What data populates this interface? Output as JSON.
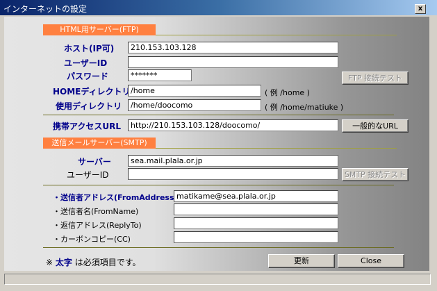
{
  "window": {
    "title": "インターネットの設定",
    "close_glyph": "x"
  },
  "sections": {
    "html_server": "HTML用サーバー(FTP)",
    "smtp_server": "送信メールサーバー(SMTP)"
  },
  "ftp": {
    "host_label": "ホスト(IP可)",
    "host_value": "210.153.103.128",
    "user_label": "ユーザーID",
    "user_value": "",
    "password_label": "パスワード",
    "password_value": "*******",
    "home_label": "HOMEディレクトリ",
    "home_value": "/home",
    "home_example": "( 例 /home )",
    "use_label": "使用ディレクトリ",
    "use_value": "/home/doocomo",
    "use_example": "( 例 /home/matiuke )",
    "test_button": "FTP 接続テスト",
    "mobile_label": "携帯アクセスURL",
    "mobile_value": "http://210.153.103.128/doocomo/",
    "url_button": "一般的なURL"
  },
  "smtp": {
    "server_label": "サーバー",
    "server_value": "sea.mail.plala.or.jp",
    "user_label": "ユーザーID",
    "user_value": "",
    "test_button": "SMTP 接続テスト",
    "from_address_label": "・送信者アドレス(FromAddress)",
    "from_address_value": "matikame@sea.plala.or.jp",
    "from_name_label": "・送信者名(FromName)",
    "from_name_value": "",
    "reply_to_label": "・返信アドレス(ReplyTo)",
    "reply_to_value": "",
    "cc_label": "・カーボンコピー(CC)",
    "cc_value": ""
  },
  "footer": {
    "note_prefix": "※",
    "note_bold": "太字",
    "note_suffix": "は必須項目です。",
    "update_button": "更新",
    "close_button": "Close"
  }
}
